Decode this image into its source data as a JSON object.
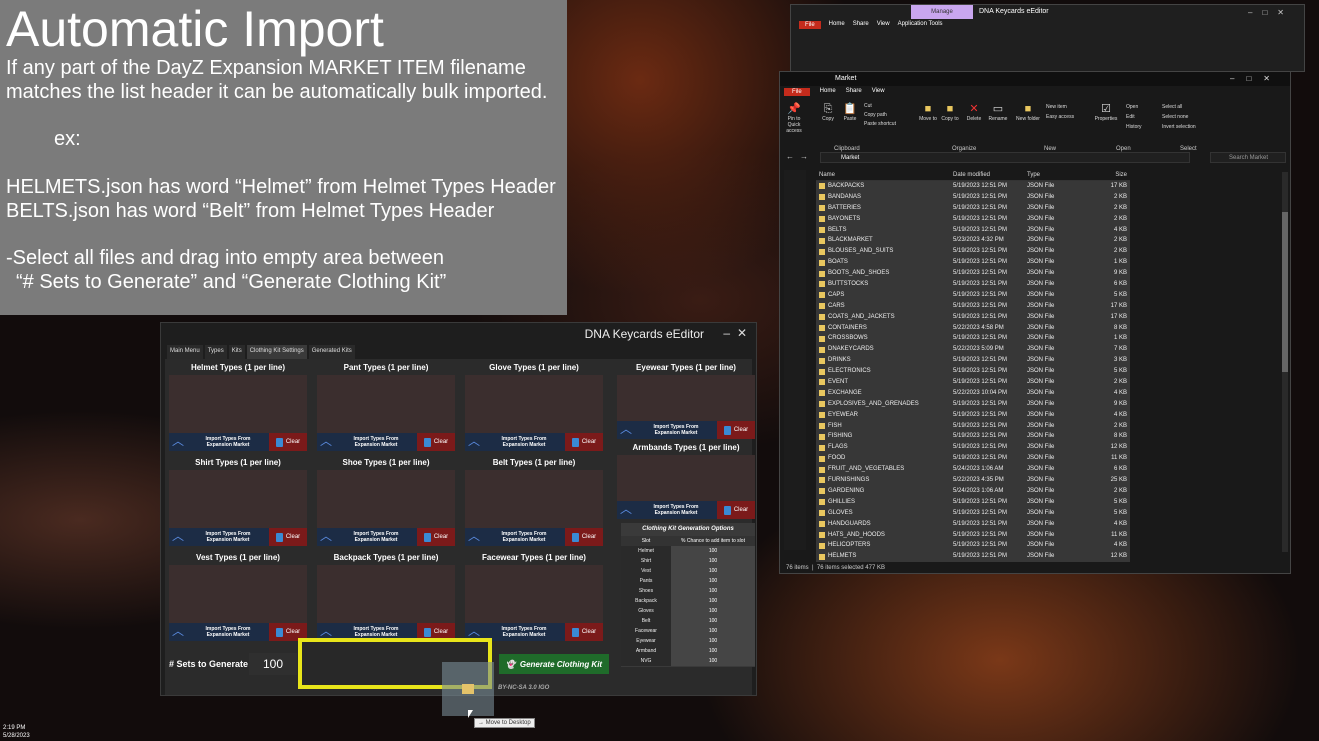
{
  "slide": {
    "title": "Automatic Import",
    "lines": [
      "If any part of the DayZ Expansion MARKET ITEM filename",
      "matches the list header it can be automatically bulk imported.",
      "ex:",
      "HELMETS.json has word “Helmet” from Helmet Types Header",
      "BELTS.json has word “Belt” from Helmet Types Header",
      "-Select all files and drag into empty area between",
      "“# Sets to Generate” and “Generate Clothing Kit”"
    ]
  },
  "app": {
    "title": "DNA Keycards eEditor",
    "minimize": "–",
    "close": "✕",
    "tabs": [
      "Main Menu",
      "Types",
      "Kits",
      "Clothing Kit Settings",
      "Generated Kits"
    ],
    "type_boxes": [
      "Helmet Types (1 per line)",
      "Pant Types (1 per line)",
      "Glove Types (1 per line)",
      "Shirt Types (1 per line)",
      "Shoe Types (1 per line)",
      "Belt Types (1 per line)",
      "Vest Types (1 per line)",
      "Backpack Types (1 per line)",
      "Facewear Types (1 per line)",
      "Eyewear Types (1 per line)",
      "Armbands Types (1 per line)"
    ],
    "import_line1": "Import Types From",
    "import_line2": "Expansion Market",
    "clear_label": "Clear",
    "options": {
      "title": "Clothing Kit Generation Options",
      "col_slot": "Slot",
      "col_chance": "% Chance to add item to slot",
      "rows": [
        {
          "slot": "Helmet",
          "value": "100"
        },
        {
          "slot": "Shirt",
          "value": "100"
        },
        {
          "slot": "Vest",
          "value": "100"
        },
        {
          "slot": "Pants",
          "value": "100"
        },
        {
          "slot": "Shoes",
          "value": "100"
        },
        {
          "slot": "Backpack",
          "value": "100"
        },
        {
          "slot": "Gloves",
          "value": "100"
        },
        {
          "slot": "Belt",
          "value": "100"
        },
        {
          "slot": "Facewear",
          "value": "100"
        },
        {
          "slot": "Eyewear",
          "value": "100"
        },
        {
          "slot": "Armband",
          "value": "100"
        },
        {
          "slot": "NVG",
          "value": "100"
        }
      ]
    },
    "sets_label": "# Sets to Generate",
    "sets_value": "100",
    "generate_label": "Generate Clothing Kit",
    "license": "BY-NC-SA 3.0 IGO"
  },
  "drag_tooltip": "→ Move to Desktop",
  "explorer_back": {
    "context_tab": "Manage",
    "title": "DNA Keycards eEditor",
    "tabs": [
      "File",
      "Home",
      "Share",
      "View",
      "Application Tools"
    ]
  },
  "explorer": {
    "title": "Market",
    "context_tab": "Manage",
    "tabs": [
      "File",
      "Home",
      "Share",
      "View"
    ],
    "ribbon": {
      "pin": "Pin to Quick access",
      "copy": "Copy",
      "paste": "Paste",
      "cut": "Cut",
      "copy_path": "Copy path",
      "paste_shortcut": "Paste shortcut",
      "move_to": "Move to",
      "copy_to": "Copy to",
      "delete": "Delete",
      "rename": "Rename",
      "new_folder": "New folder",
      "new_item": "New item",
      "easy_access": "Easy access",
      "properties": "Properties",
      "open": "Open",
      "edit": "Edit",
      "history": "History",
      "select_all": "Select all",
      "select_none": "Select none",
      "invert": "Invert selection"
    },
    "groups": [
      "Clipboard",
      "Organize",
      "New",
      "Open",
      "Select"
    ],
    "address": "Market",
    "search_placeholder": "Search Market",
    "columns": [
      "Name",
      "Date modified",
      "Type",
      "Size"
    ],
    "files": [
      [
        "BACKPACKS",
        "5/19/2023 12:51 PM",
        "JSON File",
        "17 KB"
      ],
      [
        "BANDANAS",
        "5/19/2023 12:51 PM",
        "JSON File",
        "2 KB"
      ],
      [
        "BATTERIES",
        "5/19/2023 12:51 PM",
        "JSON File",
        "2 KB"
      ],
      [
        "BAYONETS",
        "5/19/2023 12:51 PM",
        "JSON File",
        "2 KB"
      ],
      [
        "BELTS",
        "5/19/2023 12:51 PM",
        "JSON File",
        "4 KB"
      ],
      [
        "BLACKMARKET",
        "5/23/2023 4:32 PM",
        "JSON File",
        "2 KB"
      ],
      [
        "BLOUSES_AND_SUITS",
        "5/19/2023 12:51 PM",
        "JSON File",
        "2 KB"
      ],
      [
        "BOATS",
        "5/19/2023 12:51 PM",
        "JSON File",
        "1 KB"
      ],
      [
        "BOOTS_AND_SHOES",
        "5/19/2023 12:51 PM",
        "JSON File",
        "9 KB"
      ],
      [
        "BUTTSTOCKS",
        "5/19/2023 12:51 PM",
        "JSON File",
        "6 KB"
      ],
      [
        "CAPS",
        "5/19/2023 12:51 PM",
        "JSON File",
        "5 KB"
      ],
      [
        "CARS",
        "5/19/2023 12:51 PM",
        "JSON File",
        "17 KB"
      ],
      [
        "COATS_AND_JACKETS",
        "5/19/2023 12:51 PM",
        "JSON File",
        "17 KB"
      ],
      [
        "CONTAINERS",
        "5/22/2023 4:58 PM",
        "JSON File",
        "8 KB"
      ],
      [
        "CROSSBOWS",
        "5/19/2023 12:51 PM",
        "JSON File",
        "1 KB"
      ],
      [
        "DNAKEYCARDS",
        "5/22/2023 5:09 PM",
        "JSON File",
        "7 KB"
      ],
      [
        "DRINKS",
        "5/19/2023 12:51 PM",
        "JSON File",
        "3 KB"
      ],
      [
        "ELECTRONICS",
        "5/19/2023 12:51 PM",
        "JSON File",
        "5 KB"
      ],
      [
        "EVENT",
        "5/19/2023 12:51 PM",
        "JSON File",
        "2 KB"
      ],
      [
        "EXCHANGE",
        "5/22/2023 10:04 PM",
        "JSON File",
        "4 KB"
      ],
      [
        "EXPLOSIVES_AND_GRENADES",
        "5/19/2023 12:51 PM",
        "JSON File",
        "9 KB"
      ],
      [
        "EYEWEAR",
        "5/19/2023 12:51 PM",
        "JSON File",
        "4 KB"
      ],
      [
        "FISH",
        "5/19/2023 12:51 PM",
        "JSON File",
        "2 KB"
      ],
      [
        "FISHING",
        "5/19/2023 12:51 PM",
        "JSON File",
        "8 KB"
      ],
      [
        "FLAGS",
        "5/19/2023 12:51 PM",
        "JSON File",
        "12 KB"
      ],
      [
        "FOOD",
        "5/19/2023 12:51 PM",
        "JSON File",
        "11 KB"
      ],
      [
        "FRUIT_AND_VEGETABLES",
        "5/24/2023 1:06 AM",
        "JSON File",
        "6 KB"
      ],
      [
        "FURNISHINGS",
        "5/22/2023 4:35 PM",
        "JSON File",
        "25 KB"
      ],
      [
        "GARDENING",
        "5/24/2023 1:06 AM",
        "JSON File",
        "2 KB"
      ],
      [
        "GHILLIES",
        "5/19/2023 12:51 PM",
        "JSON File",
        "5 KB"
      ],
      [
        "GLOVES",
        "5/19/2023 12:51 PM",
        "JSON File",
        "5 KB"
      ],
      [
        "HANDGUARDS",
        "5/19/2023 12:51 PM",
        "JSON File",
        "4 KB"
      ],
      [
        "HATS_AND_HOODS",
        "5/19/2023 12:51 PM",
        "JSON File",
        "11 KB"
      ],
      [
        "HELICOPTERS",
        "5/19/2023 12:51 PM",
        "JSON File",
        "4 KB"
      ],
      [
        "HELMETS",
        "5/19/2023 12:51 PM",
        "JSON File",
        "12 KB"
      ]
    ],
    "status_items": "76 items",
    "status_selected": "76 items selected  477 KB"
  },
  "taskbar": {
    "time": "2:19 PM",
    "date": "5/28/2023"
  }
}
